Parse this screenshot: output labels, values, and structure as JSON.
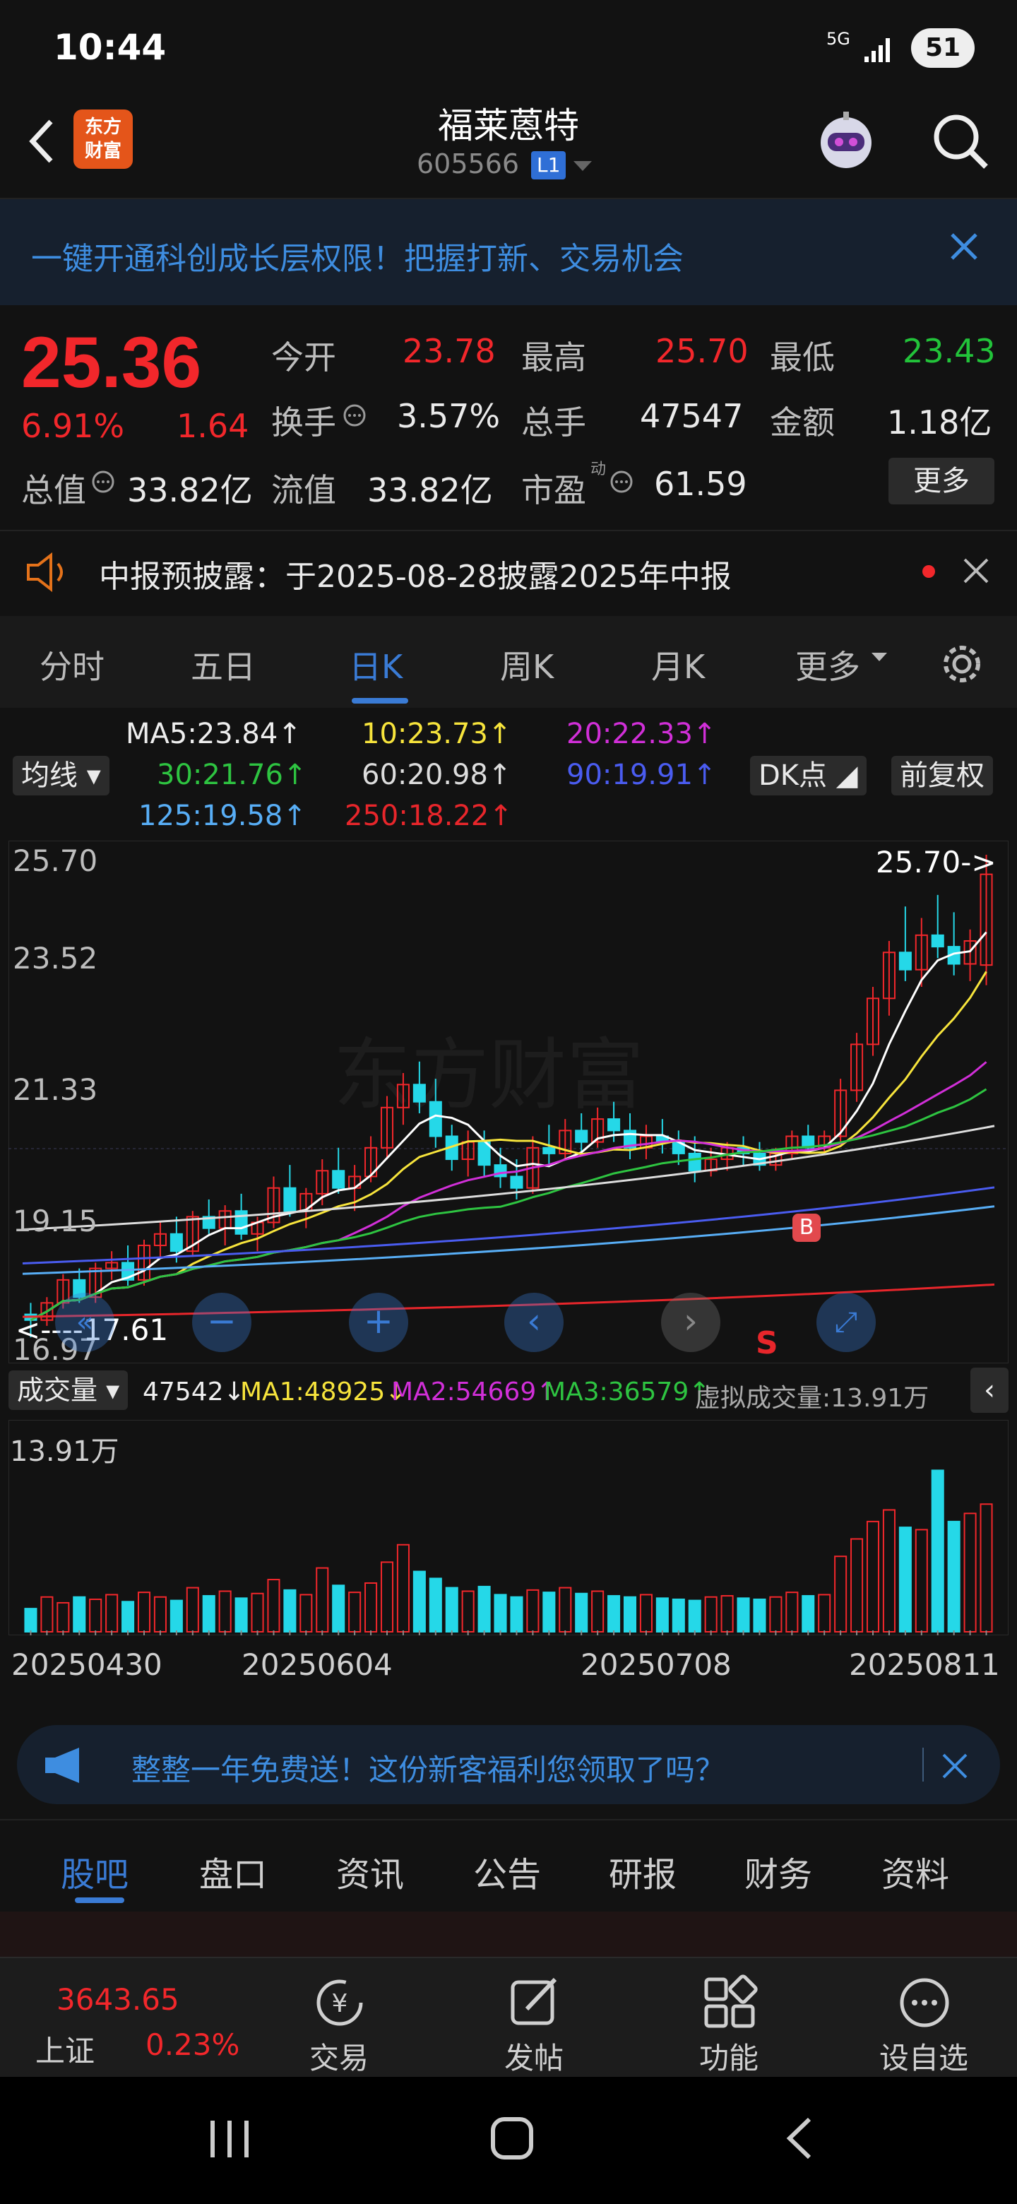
{
  "status": {
    "time": "10:44",
    "network": "5G",
    "battery": "51"
  },
  "header": {
    "stock_name": "福莱蒽特",
    "stock_code": "605566",
    "level_badge": "L1",
    "logo_line1": "东方",
    "logo_line2": "财富"
  },
  "banner": {
    "text": "一键开通科创成长层权限！把握打新、交易机会"
  },
  "quote": {
    "price": "25.36",
    "change_pct": "6.91%",
    "change_amt": "1.64",
    "open_label": "今开",
    "open": "23.78",
    "high_label": "最高",
    "high": "25.70",
    "low_label": "最低",
    "low": "23.43",
    "turnover_label": "换手",
    "turnover": "3.57%",
    "volume_label": "总手",
    "volume": "47547",
    "amount_label": "金额",
    "amount": "1.18亿",
    "mktcap_label": "总值",
    "mktcap": "33.82亿",
    "float_label": "流值",
    "float": "33.82亿",
    "pe_label": "市盈",
    "pe_sup": "动",
    "pe": "61.59",
    "more": "更多"
  },
  "notice": {
    "text": "中报预披露：于2025-08-28披露2025年中报"
  },
  "tabs": [
    "分时",
    "五日",
    "日K",
    "周K",
    "月K",
    "更多"
  ],
  "active_tab": "日K",
  "ma_legend": {
    "selector": "均线",
    "ma5": "MA5:23.84↑",
    "ma10": "10:23.73↑",
    "ma20": "20:22.33↑",
    "ma30": "30:21.76↑",
    "ma60": "60:20.98↑",
    "ma90": "90:19.91↑",
    "ma125": "125:19.58↑",
    "ma250": "250:18.22↑",
    "dk_button": "DK点",
    "adjust_button": "前复权"
  },
  "chart_labels": {
    "y_max": "25.70",
    "y2": "23.52",
    "y3": "21.33",
    "y4": "19.15",
    "y_min": "16.97",
    "high_marker": "25.70->",
    "low_marker": "<----17.61",
    "buy_marker": "B",
    "sell_marker": "S"
  },
  "volume_legend": {
    "selector": "成交量",
    "vol": "47542↓",
    "ma1": "MA1:48925↓",
    "ma2": "MA2:54669↑",
    "ma3": "MA3:36579↑",
    "virtual": "虚拟成交量:13.91万",
    "y_max": "13.91万"
  },
  "dates": [
    "20250430",
    "20250604",
    "20250708",
    "20250811"
  ],
  "ad": {
    "text": "整整一年免费送！这份新客福利您领取了吗？"
  },
  "bottom_tabs": [
    "股吧",
    "盘口",
    "资讯",
    "公告",
    "研报",
    "财务",
    "资料"
  ],
  "toolbar": {
    "index_value": "3643.65",
    "index_name": "上证",
    "index_change": "0.23%",
    "trade": "交易",
    "post": "发帖",
    "function": "功能",
    "watchlist": "设自选"
  },
  "colors": {
    "up": "#f2272b",
    "down": "#22c33a",
    "accent": "#3a7bd5",
    "bg": "#121212"
  },
  "chart_data": {
    "type": "candlestick",
    "title": "",
    "ylim": [
      16.97,
      25.7
    ],
    "x_labels": [
      "20250430",
      "20250604",
      "20250708",
      "20250811"
    ],
    "ohlc": [
      [
        17.7,
        17.9,
        17.3,
        17.6
      ],
      [
        17.6,
        18.0,
        17.5,
        17.9
      ],
      [
        17.9,
        18.4,
        17.8,
        18.3
      ],
      [
        18.3,
        18.5,
        17.9,
        18.0
      ],
      [
        18.0,
        18.6,
        17.9,
        18.5
      ],
      [
        18.5,
        18.8,
        18.3,
        18.6
      ],
      [
        18.6,
        18.9,
        18.2,
        18.3
      ],
      [
        18.3,
        19.0,
        18.2,
        18.9
      ],
      [
        18.9,
        19.3,
        18.7,
        19.1
      ],
      [
        19.1,
        19.4,
        18.6,
        18.8
      ],
      [
        18.8,
        19.5,
        18.7,
        19.4
      ],
      [
        19.4,
        19.7,
        19.1,
        19.2
      ],
      [
        19.2,
        19.6,
        18.9,
        19.5
      ],
      [
        19.5,
        19.8,
        19.0,
        19.1
      ],
      [
        19.1,
        19.4,
        18.8,
        19.3
      ],
      [
        19.3,
        20.1,
        19.2,
        19.9
      ],
      [
        19.9,
        20.3,
        19.4,
        19.5
      ],
      [
        19.5,
        19.9,
        19.2,
        19.8
      ],
      [
        19.8,
        20.4,
        19.6,
        20.2
      ],
      [
        20.2,
        20.6,
        19.8,
        19.9
      ],
      [
        19.9,
        20.3,
        19.5,
        20.1
      ],
      [
        20.1,
        20.8,
        20.0,
        20.6
      ],
      [
        20.6,
        21.5,
        20.4,
        21.3
      ],
      [
        21.3,
        21.9,
        21.0,
        21.7
      ],
      [
        21.7,
        22.1,
        21.2,
        21.4
      ],
      [
        21.4,
        21.8,
        20.6,
        20.8
      ],
      [
        20.8,
        21.0,
        20.2,
        20.4
      ],
      [
        20.4,
        20.9,
        20.1,
        20.7
      ],
      [
        20.7,
        20.9,
        20.1,
        20.3
      ],
      [
        20.3,
        20.6,
        19.9,
        20.1
      ],
      [
        20.1,
        20.4,
        19.7,
        19.9
      ],
      [
        19.9,
        20.8,
        19.8,
        20.6
      ],
      [
        20.6,
        21.0,
        20.3,
        20.5
      ],
      [
        20.5,
        21.1,
        20.4,
        20.9
      ],
      [
        20.9,
        21.2,
        20.5,
        20.7
      ],
      [
        20.7,
        21.3,
        20.6,
        21.1
      ],
      [
        21.1,
        21.4,
        20.7,
        20.9
      ],
      [
        20.9,
        21.2,
        20.4,
        20.6
      ],
      [
        20.6,
        21.0,
        20.4,
        20.8
      ],
      [
        20.8,
        21.1,
        20.5,
        20.7
      ],
      [
        20.7,
        20.9,
        20.3,
        20.5
      ],
      [
        20.5,
        20.8,
        20.0,
        20.2
      ],
      [
        20.2,
        20.6,
        20.1,
        20.4
      ],
      [
        20.4,
        20.7,
        20.2,
        20.6
      ],
      [
        20.6,
        20.8,
        20.3,
        20.5
      ],
      [
        20.5,
        20.7,
        20.2,
        20.3
      ],
      [
        20.3,
        20.6,
        20.2,
        20.5
      ],
      [
        20.5,
        20.9,
        20.4,
        20.8
      ],
      [
        20.8,
        21.0,
        20.5,
        20.6
      ],
      [
        20.6,
        20.9,
        20.5,
        20.8
      ],
      [
        20.8,
        21.8,
        20.7,
        21.6
      ],
      [
        21.6,
        22.6,
        21.4,
        22.4
      ],
      [
        22.4,
        23.4,
        22.2,
        23.2
      ],
      [
        23.2,
        24.2,
        22.9,
        24.0
      ],
      [
        24.0,
        24.8,
        23.5,
        23.7
      ],
      [
        23.7,
        24.6,
        23.4,
        24.3
      ],
      [
        24.3,
        25.0,
        23.9,
        24.1
      ],
      [
        24.1,
        24.7,
        23.6,
        23.8
      ],
      [
        23.8,
        24.4,
        23.5,
        24.2
      ],
      [
        23.78,
        25.7,
        23.43,
        25.36
      ]
    ],
    "ma": {
      "MA5": 23.84,
      "MA10": 23.73,
      "MA20": 22.33,
      "MA30": 21.76,
      "MA60": 20.98,
      "MA90": 19.91,
      "MA125": 19.58,
      "MA250": 18.22
    },
    "volume_max": "13.91万",
    "volume": [
      2,
      3,
      2.5,
      3,
      2.8,
      3.2,
      2.6,
      3.4,
      3,
      2.7,
      3.8,
      3.1,
      3.5,
      2.9,
      3.3,
      4.5,
      3.6,
      3.2,
      5.5,
      4,
      3.4,
      4.2,
      6,
      7.5,
      5.2,
      4.6,
      3.8,
      3.5,
      3.9,
      3.2,
      3,
      3.6,
      3.4,
      3.8,
      3.3,
      3.5,
      3.1,
      3,
      3.2,
      2.9,
      2.8,
      2.7,
      3,
      3.1,
      2.9,
      2.8,
      3,
      3.4,
      3.1,
      3.2,
      6.5,
      8,
      9.5,
      10.5,
      9,
      8.8,
      13.91,
      9.5,
      10.2,
      11
    ]
  }
}
